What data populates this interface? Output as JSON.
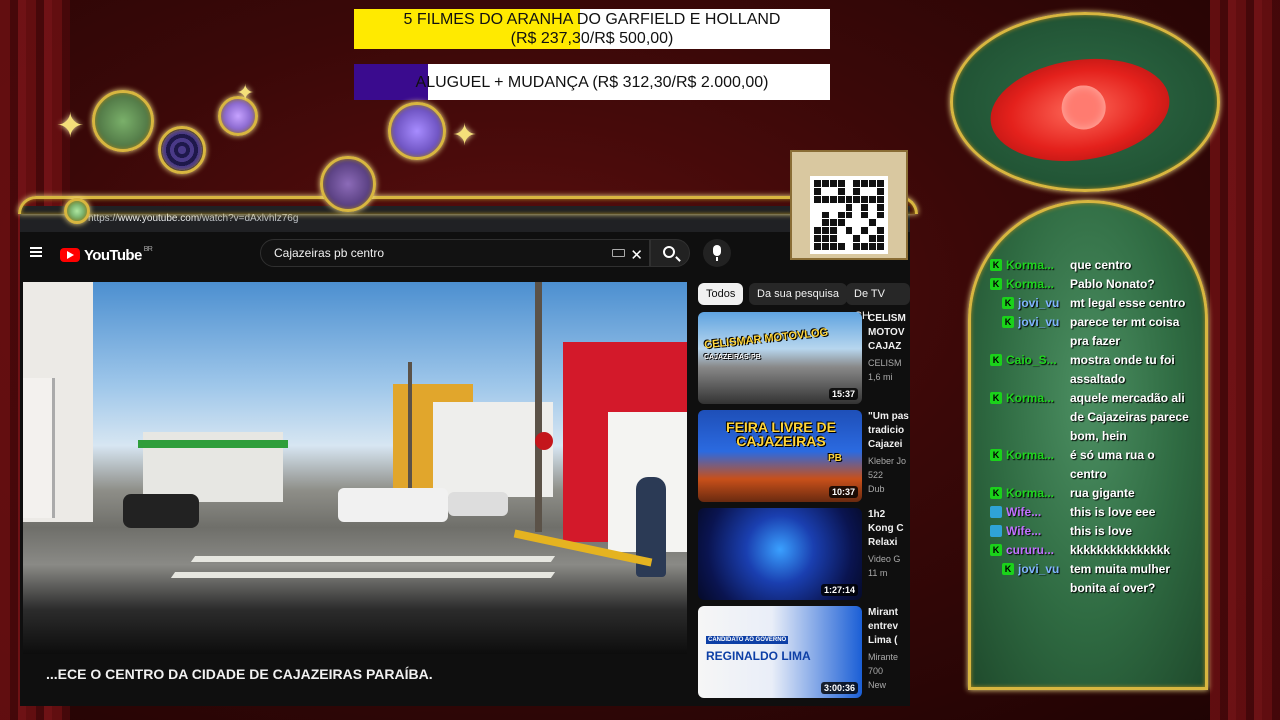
{
  "goals": [
    {
      "label": "5 FILMES DO ARANHA DO GARFIELD E HOLLAND",
      "amounts": "(R$ 237,30/R$ 500,00)",
      "progress": 0.4746
    },
    {
      "label": "ALUGUEL + MUDANÇA (R$ 312,30/R$ 2.000,00)",
      "progress": 0.1562
    }
  ],
  "browser": {
    "url_prefix": "https://",
    "url_domain": "www.youtube.com",
    "url_path": "/watch?v=dAxlvhlz76g"
  },
  "youtube": {
    "logo_text": "YouTube",
    "country": "BR",
    "search_value": "Cajazeiras pb centro",
    "video_title": "...ECE O CENTRO DA CIDADE DE CAJAZEIRAS PARAÍBA.",
    "chips": [
      "Todos",
      "Da sua pesquisa",
      "De TV CH"
    ],
    "related": [
      {
        "title_lines": [
          "CELISM",
          "MOTOV",
          "CAJAZ"
        ],
        "channel_lines": [
          "CELISM",
          "1,6 mi"
        ],
        "duration": "15:37",
        "thumb_text": "CELISMAR MOTOVLOG",
        "thumb_sub": "CAJAZEIRAS-PB"
      },
      {
        "title_lines": [
          "\"Um pas",
          "tradicio",
          "Cajazei"
        ],
        "channel_lines": [
          "Kleber Jo",
          "522",
          "Dub"
        ],
        "duration": "10:37",
        "thumb_text": "FEIRA LIVRE DE CAJAZEIRAS",
        "thumb_sub": "PB"
      },
      {
        "title_lines": [
          "1h2",
          "Kong C",
          "Relaxi"
        ],
        "channel_lines": [
          "Video G",
          "11 m"
        ],
        "duration": "1:27:14"
      },
      {
        "title_lines": [
          "Mirant",
          "entrev",
          "Lima ("
        ],
        "channel_lines": [
          "Mirante",
          "700",
          "New"
        ],
        "duration": "3:00:36",
        "thumb_text": "REGINALDO LIMA",
        "thumb_sub": "CANDIDATO AO GOVERNO"
      }
    ]
  },
  "chat": [
    {
      "user": "Korma...",
      "text": "que centro",
      "user_color": "#1fd51f",
      "badge": "k"
    },
    {
      "user": "Korma...",
      "text": "Pablo Nonato?",
      "user_color": "#1fd51f",
      "badge": "k"
    },
    {
      "user": "jovi_vu",
      "text": "mt legal esse centro",
      "user_color": "#7fb4ff",
      "badge": "k",
      "indent": true
    },
    {
      "user": "jovi_vu",
      "text": "parece ter mt coisa pra fazer",
      "user_color": "#7fb4ff",
      "badge": "k",
      "indent": true
    },
    {
      "user": "Caio_S...",
      "text": "mostra onde tu foi assaltado",
      "user_color": "#1fd51f",
      "badge": "k"
    },
    {
      "user": "Korma...",
      "text": "aquele mercadão ali de Cajazeiras parece bom, hein",
      "user_color": "#1fd51f",
      "badge": "k"
    },
    {
      "user": "Korma...",
      "text": "é só uma rua o centro",
      "user_color": "#1fd51f",
      "badge": "k"
    },
    {
      "user": "Korma...",
      "text": "rua gigante",
      "user_color": "#1fd51f",
      "badge": "k"
    },
    {
      "user": "Wife...",
      "text": "this is love eee",
      "user_color": "#c070ff",
      "badge": "k2"
    },
    {
      "user": "Wife...",
      "text": "this is love",
      "user_color": "#c070ff",
      "badge": "k2"
    },
    {
      "user": "cururu...",
      "text": "kkkkkkkkkkkkkkk",
      "user_color": "#c070ff",
      "badge": "k"
    },
    {
      "user": "jovi_vu",
      "text": "tem muita mulher bonita aí over?",
      "user_color": "#7fb4ff",
      "badge": "k",
      "indent": true
    }
  ],
  "colors": {
    "goal1_fill": "#ffea00",
    "goal2_fill": "#3a0b8e",
    "yt_red": "#ff0000",
    "chat_badge": "#1ad21a",
    "frame_gold": "#d8b640"
  },
  "icons": [
    "hamburger-icon",
    "keyboard-icon",
    "close-icon",
    "search-icon",
    "microphone-icon",
    "eye-icon",
    "qr-code"
  ]
}
